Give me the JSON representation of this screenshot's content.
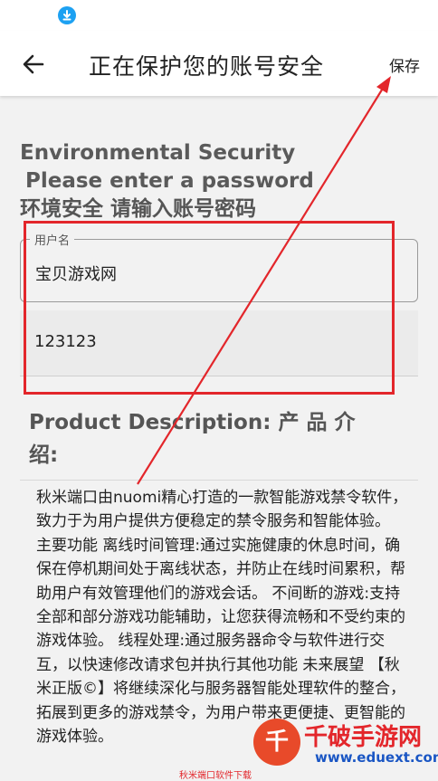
{
  "status_bar": {
    "download_icon": "download-icon"
  },
  "app_bar": {
    "back_icon": "back-arrow-icon",
    "title": "正在保护您的账号安全",
    "save_label": "保存"
  },
  "env_heading": {
    "line1": "Environmental Security",
    "line2": "Please enter a password",
    "line3": "环境安全 请输入账号密码"
  },
  "form": {
    "username_label": "用户名",
    "username_value": "宝贝游戏网",
    "password_value": "123123"
  },
  "product": {
    "heading": "Product Description:  产 品 介 绍:",
    "description": "秋米端口由nuomi精心打造的一款智能游戏禁令软件，致力于为用户提供方便稳定的禁令服务和智能体验。 主要功能  离线时间管理:通过实施健康的休息时间，确保在停机期间处于离线状态，并防止在线时间累积，帮助用户有效管理他们的游戏会话。 不间断的游戏:支持全部和部分游戏功能辅助，让您获得流畅和不受约束的游戏体验。 线程处理:通过服务器命令与软件进行交互，以快速修改请求包并执行其他功能  未来展望 【秋米正版©】将继续深化与服务器智能处理软件的整合，拓展到更多的游戏禁令，为用户带来更便捷、更智能的游戏体验。"
  },
  "watermark": {
    "logo_text": "千",
    "title": "千破手游网",
    "url": "www.eduext.com",
    "sub": "秋米端口软件下载"
  },
  "colors": {
    "highlight": "#e3262b",
    "accent": "#1da1f2"
  }
}
